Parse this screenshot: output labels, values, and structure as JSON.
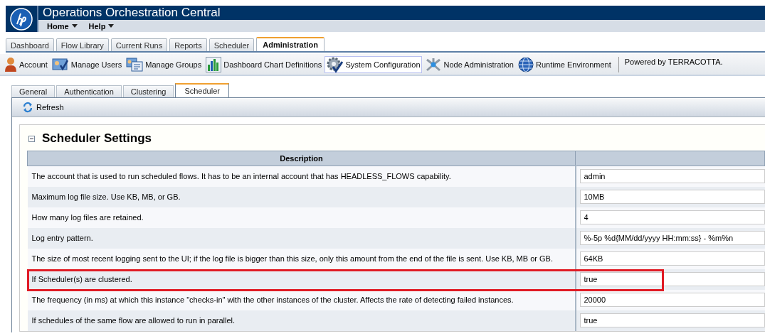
{
  "app": {
    "title": "Operations Orchestration Central",
    "menus": [
      {
        "label": "Home"
      },
      {
        "label": "Help"
      }
    ]
  },
  "tabs": [
    {
      "label": "Dashboard",
      "selected": false
    },
    {
      "label": "Flow Library",
      "selected": false
    },
    {
      "label": "Current Runs",
      "selected": false
    },
    {
      "label": "Reports",
      "selected": false
    },
    {
      "label": "Scheduler",
      "selected": false
    },
    {
      "label": "Administration",
      "selected": true
    }
  ],
  "toolbar": {
    "items": [
      {
        "label": "Account",
        "kind": "person",
        "selected": false
      },
      {
        "label": "Manage Users",
        "kind": "users",
        "selected": false
      },
      {
        "label": "Manage Groups",
        "kind": "groups",
        "selected": false
      },
      {
        "label": "Dashboard Chart Definitions",
        "kind": "chart",
        "selected": false
      },
      {
        "label": "System Configuration",
        "kind": "gear",
        "selected": true
      },
      {
        "label": "Node Administration",
        "kind": "node",
        "selected": false
      },
      {
        "label": "Runtime Environment",
        "kind": "globe",
        "selected": false
      }
    ],
    "powered_by": "Powered by TERRACOTTA."
  },
  "sub_tabs": [
    {
      "label": "General",
      "selected": false
    },
    {
      "label": "Authentication",
      "selected": false
    },
    {
      "label": "Clustering",
      "selected": false
    },
    {
      "label": "Scheduler",
      "selected": true
    }
  ],
  "refresh_button": "Refresh",
  "section": {
    "title": "Scheduler Settings",
    "expanded": true
  },
  "table": {
    "columns": [
      "Description"
    ],
    "rows": [
      {
        "description": "The account that is used to run scheduled flows. It has to be an internal account that has HEADLESS_FLOWS capability.",
        "value": "admin",
        "highlighted": false
      },
      {
        "description": "Maximum log file size. Use KB, MB, or GB.",
        "value": "10MB",
        "highlighted": false
      },
      {
        "description": "How many log files are retained.",
        "value": "4",
        "highlighted": false
      },
      {
        "description": "Log entry pattern.",
        "value": "%-5p %d{MM/dd/yyyy HH:mm:ss} - %m%n",
        "highlighted": false
      },
      {
        "description": "The size of most recent logging sent to the UI; if the log file is bigger than this size, only this amount from the end of the file is sent. Use KB, MB or GB.",
        "value": "64KB",
        "highlighted": false
      },
      {
        "description": "If Scheduler(s) are clustered.",
        "value": "true",
        "highlighted": true
      },
      {
        "description": "The frequency (in ms) at which this instance \"checks-in\" with the other instances of the cluster. Affects the rate of detecting failed instances.",
        "value": "20000",
        "highlighted": false
      },
      {
        "description": "If schedules of the same flow are allowed to run in parallel.",
        "value": "true",
        "highlighted": false
      }
    ]
  }
}
